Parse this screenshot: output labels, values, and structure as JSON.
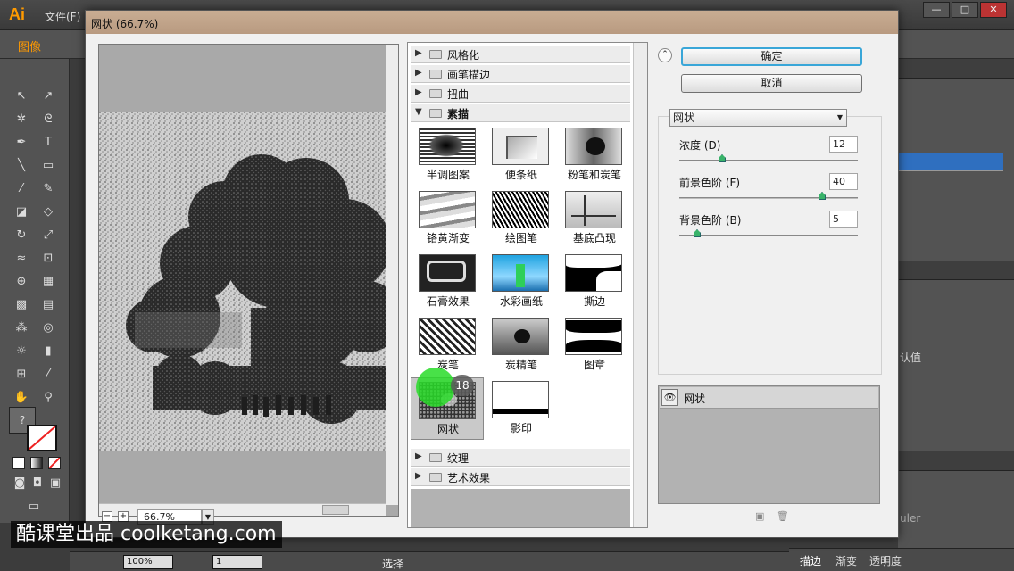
{
  "app": {
    "logo": "Ai",
    "menu_file": "文件(F)",
    "control_label": "图像",
    "window_buttons": [
      "—",
      "□",
      "✕"
    ]
  },
  "dialog": {
    "title": "网状 (66.7%)",
    "ok_label": "确定",
    "cancel_label": "取消",
    "zoom_value": "66.7%",
    "collapse_icon": "chevron-double-up"
  },
  "gallery": {
    "categories_top": [
      {
        "label": "风格化",
        "open": false
      },
      {
        "label": "画笔描边",
        "open": false
      },
      {
        "label": "扭曲",
        "open": false
      },
      {
        "label": "素描",
        "open": true
      }
    ],
    "sketch_thumbnails": [
      {
        "label": "半调图案",
        "style": "halftone"
      },
      {
        "label": "便条纸",
        "style": "notepaper"
      },
      {
        "label": "粉笔和炭笔",
        "style": "chalk"
      },
      {
        "label": "铬黄渐变",
        "style": "chrome"
      },
      {
        "label": "绘图笔",
        "style": "pen"
      },
      {
        "label": "基底凸现",
        "style": "relief"
      },
      {
        "label": "石膏效果",
        "style": "plaster"
      },
      {
        "label": "水彩画纸",
        "style": "watercolor"
      },
      {
        "label": "撕边",
        "style": "torn"
      },
      {
        "label": "炭笔",
        "style": "charcoal"
      },
      {
        "label": "炭精笔",
        "style": "conte"
      },
      {
        "label": "图章",
        "style": "stamp"
      },
      {
        "label": "网状",
        "style": "reticulation",
        "selected": true
      },
      {
        "label": "影印",
        "style": "photocopy"
      }
    ],
    "categories_bottom": [
      {
        "label": "纹理"
      },
      {
        "label": "艺术效果"
      }
    ]
  },
  "settings": {
    "filter_select": "网状",
    "params": [
      {
        "label": "浓度 (D)",
        "value": "12",
        "slider": 0.24
      },
      {
        "label": "前景色阶 (F)",
        "value": "40",
        "slider": 0.8
      },
      {
        "label": "背景色阶 (B)",
        "value": "5",
        "slider": 0.1
      }
    ]
  },
  "effect_layers": {
    "items": [
      {
        "label": "网状",
        "visible": true
      }
    ]
  },
  "statusbar": {
    "zoom": "100%",
    "page": "1",
    "tool": "选择"
  },
  "right_panel": {
    "text1": "认值",
    "text2": "uler"
  },
  "bottom_tabs": [
    "描边",
    "渐变",
    "透明度"
  ],
  "overlay": {
    "click_count": "18",
    "watermark": "酷课堂出品 coolketang.com"
  },
  "colors": {
    "accent_blue": "#39a6d8",
    "slider_green": "#39b36a",
    "illustrator_orange": "#ff9a00",
    "cursor_green": "#28dc28"
  }
}
